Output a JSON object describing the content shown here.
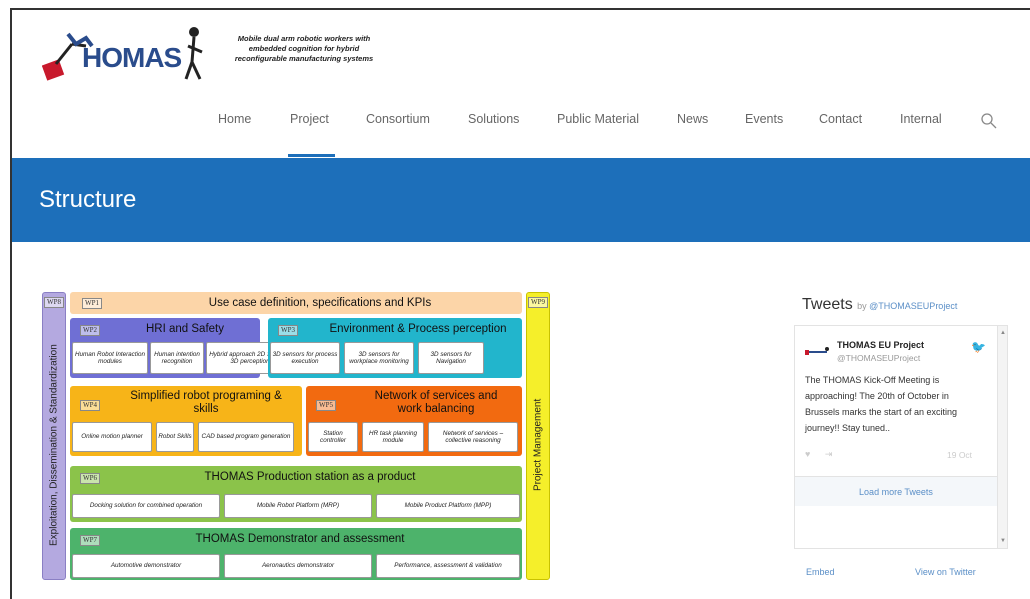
{
  "header": {
    "logo_text": "HOMAS",
    "tagline_lines": [
      "Mobile dual arm robotic workers with",
      "embedded cognition for hybrid",
      "reconfigurable manufacturing systems"
    ]
  },
  "nav": {
    "items": [
      {
        "label": "Home"
      },
      {
        "label": "Project"
      },
      {
        "label": "Consortium"
      },
      {
        "label": "Solutions"
      },
      {
        "label": "Public Material"
      },
      {
        "label": "News"
      },
      {
        "label": "Events"
      },
      {
        "label": "Contact"
      },
      {
        "label": "Internal"
      }
    ],
    "active": "Project",
    "search_icon": "search-icon"
  },
  "banner": {
    "title": "Structure"
  },
  "diagram": {
    "wp8": {
      "tag": "WP8",
      "label": "Exploitation, Dissemination & Standardization"
    },
    "wp9": {
      "tag": "WP9",
      "label": "Project Management"
    },
    "wp1": {
      "tag": "WP1",
      "title": "Use case definition, specifications and KPIs"
    },
    "wp2": {
      "tag": "WP2",
      "title": "HRI and Safety",
      "cells": [
        "Human Robot Interaction modules",
        "Human intention recognition",
        "Hybrid approach 2D Safety & 3D perception"
      ]
    },
    "wp3": {
      "tag": "WP3",
      "title": "Environment & Process perception",
      "cells": [
        "3D sensors for process execution",
        "3D sensors for workplace monitoring",
        "3D sensors for Navigation"
      ]
    },
    "wp4": {
      "tag": "WP4",
      "title_lines": [
        "Simplified robot programing &",
        "skills"
      ],
      "cells": [
        "Online motion planner",
        "Robot Skills",
        "CAD based program generation"
      ]
    },
    "wp5": {
      "tag": "WP5",
      "title_lines": [
        "Network of services and",
        "work balancing"
      ],
      "cells": [
        "Station controller",
        "HR task planning module",
        "Network of services – collective reasoning"
      ]
    },
    "wp6": {
      "tag": "WP6",
      "title": "THOMAS Production station as a product",
      "cells": [
        "Docking solution for combined operation",
        "Mobile Robot Platform (MRP)",
        "Mobile Product Platform (MPP)"
      ]
    },
    "wp7": {
      "tag": "WP7",
      "title": "THOMAS Demonstrator and assessment",
      "cells": [
        "Automotive demonstrator",
        "Aeronautics demonstrator",
        "Performance, assessment & validation"
      ]
    },
    "colors": {
      "wp1": "#fcd5a8",
      "wp2": "#6f6fd4",
      "wp3": "#22b5cc",
      "wp4": "#f7b418",
      "wp5": "#f26a10",
      "wp6": "#8bc34a",
      "wp7": "#4db36b",
      "wp8": "#b4a9e0",
      "wp9": "#f5ef2a"
    }
  },
  "tweets": {
    "heading": "Tweets",
    "by": "by",
    "handle_link": "@THOMASEUProject",
    "tweet": {
      "name": "THOMAS EU Project",
      "handle": "@THOMASEUProject",
      "body": "The THOMAS Kick-Off Meeting is approaching! The 20th of October in Brussels marks the start of an exciting journey!! Stay tuned..",
      "date": "19 Oct"
    },
    "load_more": "Load more Tweets",
    "embed": "Embed",
    "view_on_twitter": "View on Twitter"
  }
}
